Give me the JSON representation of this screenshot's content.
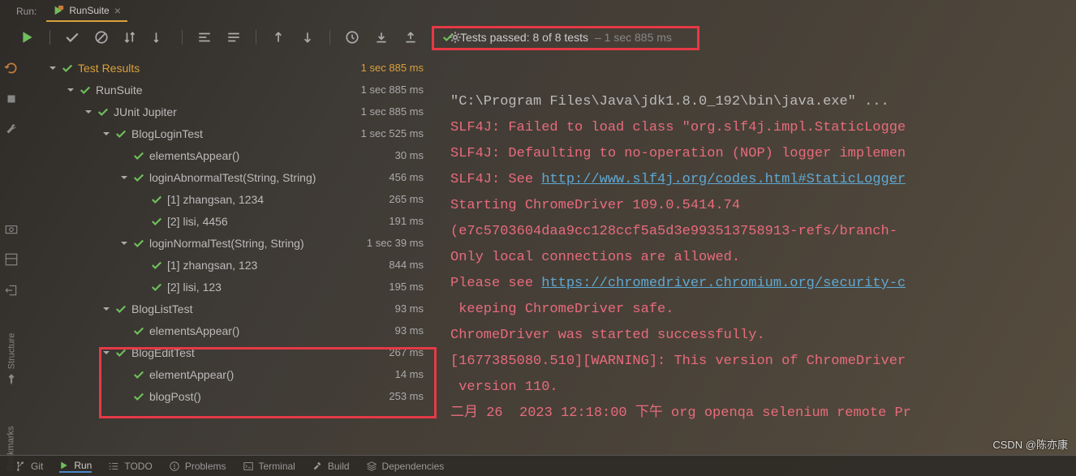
{
  "tab": {
    "label": "Run:",
    "active": "RunSuite"
  },
  "status": {
    "passed": "Tests passed: 8 of 8 tests",
    "time": "– 1 sec 885 ms"
  },
  "tree": [
    {
      "depth": 0,
      "chevron": true,
      "check": true,
      "name": "Test Results",
      "time": "1 sec 885 ms",
      "root": true
    },
    {
      "depth": 1,
      "chevron": true,
      "check": true,
      "name": "RunSuite",
      "time": "1 sec 885 ms"
    },
    {
      "depth": 2,
      "chevron": true,
      "check": true,
      "name": "JUnit Jupiter",
      "time": "1 sec 885 ms"
    },
    {
      "depth": 3,
      "chevron": true,
      "check": true,
      "name": "BlogLoginTest",
      "time": "1 sec 525 ms"
    },
    {
      "depth": 4,
      "chevron": false,
      "check": true,
      "name": "elementsAppear()",
      "time": "30 ms"
    },
    {
      "depth": 4,
      "chevron": true,
      "check": true,
      "name": "loginAbnormalTest(String, String)",
      "time": "456 ms"
    },
    {
      "depth": 5,
      "chevron": false,
      "check": true,
      "name": "[1] zhangsan, 1234",
      "time": "265 ms"
    },
    {
      "depth": 5,
      "chevron": false,
      "check": true,
      "name": "[2] lisi, 4456",
      "time": "191 ms"
    },
    {
      "depth": 4,
      "chevron": true,
      "check": true,
      "name": "loginNormalTest(String, String)",
      "time": "1 sec 39 ms"
    },
    {
      "depth": 5,
      "chevron": false,
      "check": true,
      "name": "[1] zhangsan, 123",
      "time": "844 ms"
    },
    {
      "depth": 5,
      "chevron": false,
      "check": true,
      "name": "[2] lisi, 123",
      "time": "195 ms"
    },
    {
      "depth": 3,
      "chevron": true,
      "check": true,
      "name": "BlogListTest",
      "time": "93 ms"
    },
    {
      "depth": 4,
      "chevron": false,
      "check": true,
      "name": "elementsAppear()",
      "time": "93 ms"
    },
    {
      "depth": 3,
      "chevron": true,
      "check": true,
      "name": "BlogEditTest",
      "time": "267 ms"
    },
    {
      "depth": 4,
      "chevron": false,
      "check": true,
      "name": "elementAppear()",
      "time": "14 ms"
    },
    {
      "depth": 4,
      "chevron": false,
      "check": true,
      "name": "blogPost()",
      "time": "253 ms"
    }
  ],
  "console": {
    "line1": "\"C:\\Program Files\\Java\\jdk1.8.0_192\\bin\\java.exe\" ...",
    "line2a": "SLF4J: Failed to load class \"org.slf4j.impl.StaticLogge",
    "line2b": "SLF4J: Defaulting to no-operation (NOP) logger implemen",
    "line2c": "SLF4J: See ",
    "link1": "http://www.slf4j.org/codes.html#StaticLogger",
    "line3": "Starting ChromeDriver 109.0.5414.74",
    "line4": "(e7c5703604daa9cc128ccf5a5d3e993513758913-refs/branch-",
    "line5": "Only local connections are allowed.",
    "line6a": "Please see ",
    "link2": "https://chromedriver.chromium.org/security-c",
    "line7": " keeping ChromeDriver safe.",
    "line8": "ChromeDriver was started successfully.",
    "line9": "[1677385080.510][WARNING]: This version of ChromeDriver",
    "line10": " version 110.",
    "line11": "二月 26  2023 12:18:00 下午 org openqa selenium remote Pr"
  },
  "bottom": {
    "git": "Git",
    "run": "Run",
    "todo": "TODO",
    "problems": "Problems",
    "terminal": "Terminal",
    "build": "Build",
    "deps": "Dependencies"
  },
  "rail": {
    "structure": "Structure",
    "bookmarks": "Bookmarks"
  },
  "watermark": "CSDN @陈亦康"
}
